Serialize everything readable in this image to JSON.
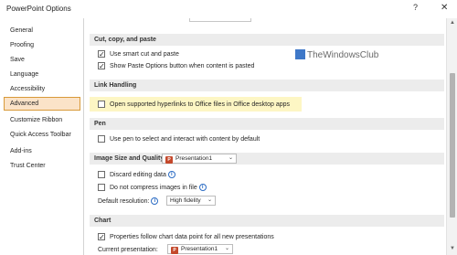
{
  "window": {
    "title": "PowerPoint Options",
    "help_label": "?",
    "close_label": "✕"
  },
  "sidebar": {
    "items": [
      {
        "label": "General"
      },
      {
        "label": "Proofing"
      },
      {
        "label": "Save"
      },
      {
        "label": "Language"
      },
      {
        "label": "Accessibility"
      },
      {
        "label": "Advanced",
        "selected": true
      },
      {
        "label": "Customize Ribbon"
      },
      {
        "label": "Quick Access Toolbar"
      },
      {
        "label": "Add-ins"
      },
      {
        "label": "Trust Center"
      }
    ]
  },
  "sections": {
    "cut_copy_paste": {
      "title": "Cut, copy, and paste",
      "smart_cut": {
        "label": "Use smart cut and paste",
        "checked": true
      },
      "paste_options": {
        "label": "Show Paste Options button when content is pasted",
        "checked": true
      }
    },
    "link_handling": {
      "title": "Link Handling",
      "open_hyperlinks": {
        "label": "Open supported hyperlinks to Office files in Office desktop apps",
        "checked": false
      }
    },
    "pen": {
      "title": "Pen",
      "use_pen": {
        "label": "Use pen to select and interact with content by default",
        "checked": false
      }
    },
    "image_size_quality": {
      "title": "Image Size and Quality",
      "presentation_dropdown": "Presentation1",
      "discard_editing": {
        "label": "Discard editing data",
        "checked": false
      },
      "no_compress": {
        "label": "Do not compress images in file",
        "checked": false
      },
      "default_resolution_label": "Default resolution:",
      "default_resolution_value": "High fidelity"
    },
    "chart": {
      "title": "Chart",
      "properties_follow": {
        "label": "Properties follow chart data point for all new presentations",
        "checked": true
      },
      "current_presentation_label": "Current presentation:",
      "current_presentation_value": "Presentation1"
    }
  },
  "watermark": {
    "text": "TheWindowsClub"
  },
  "icons": {
    "info": "i",
    "ppt": "P",
    "chevron": "⌄",
    "scroll_up": "▲",
    "scroll_down": "▼"
  }
}
